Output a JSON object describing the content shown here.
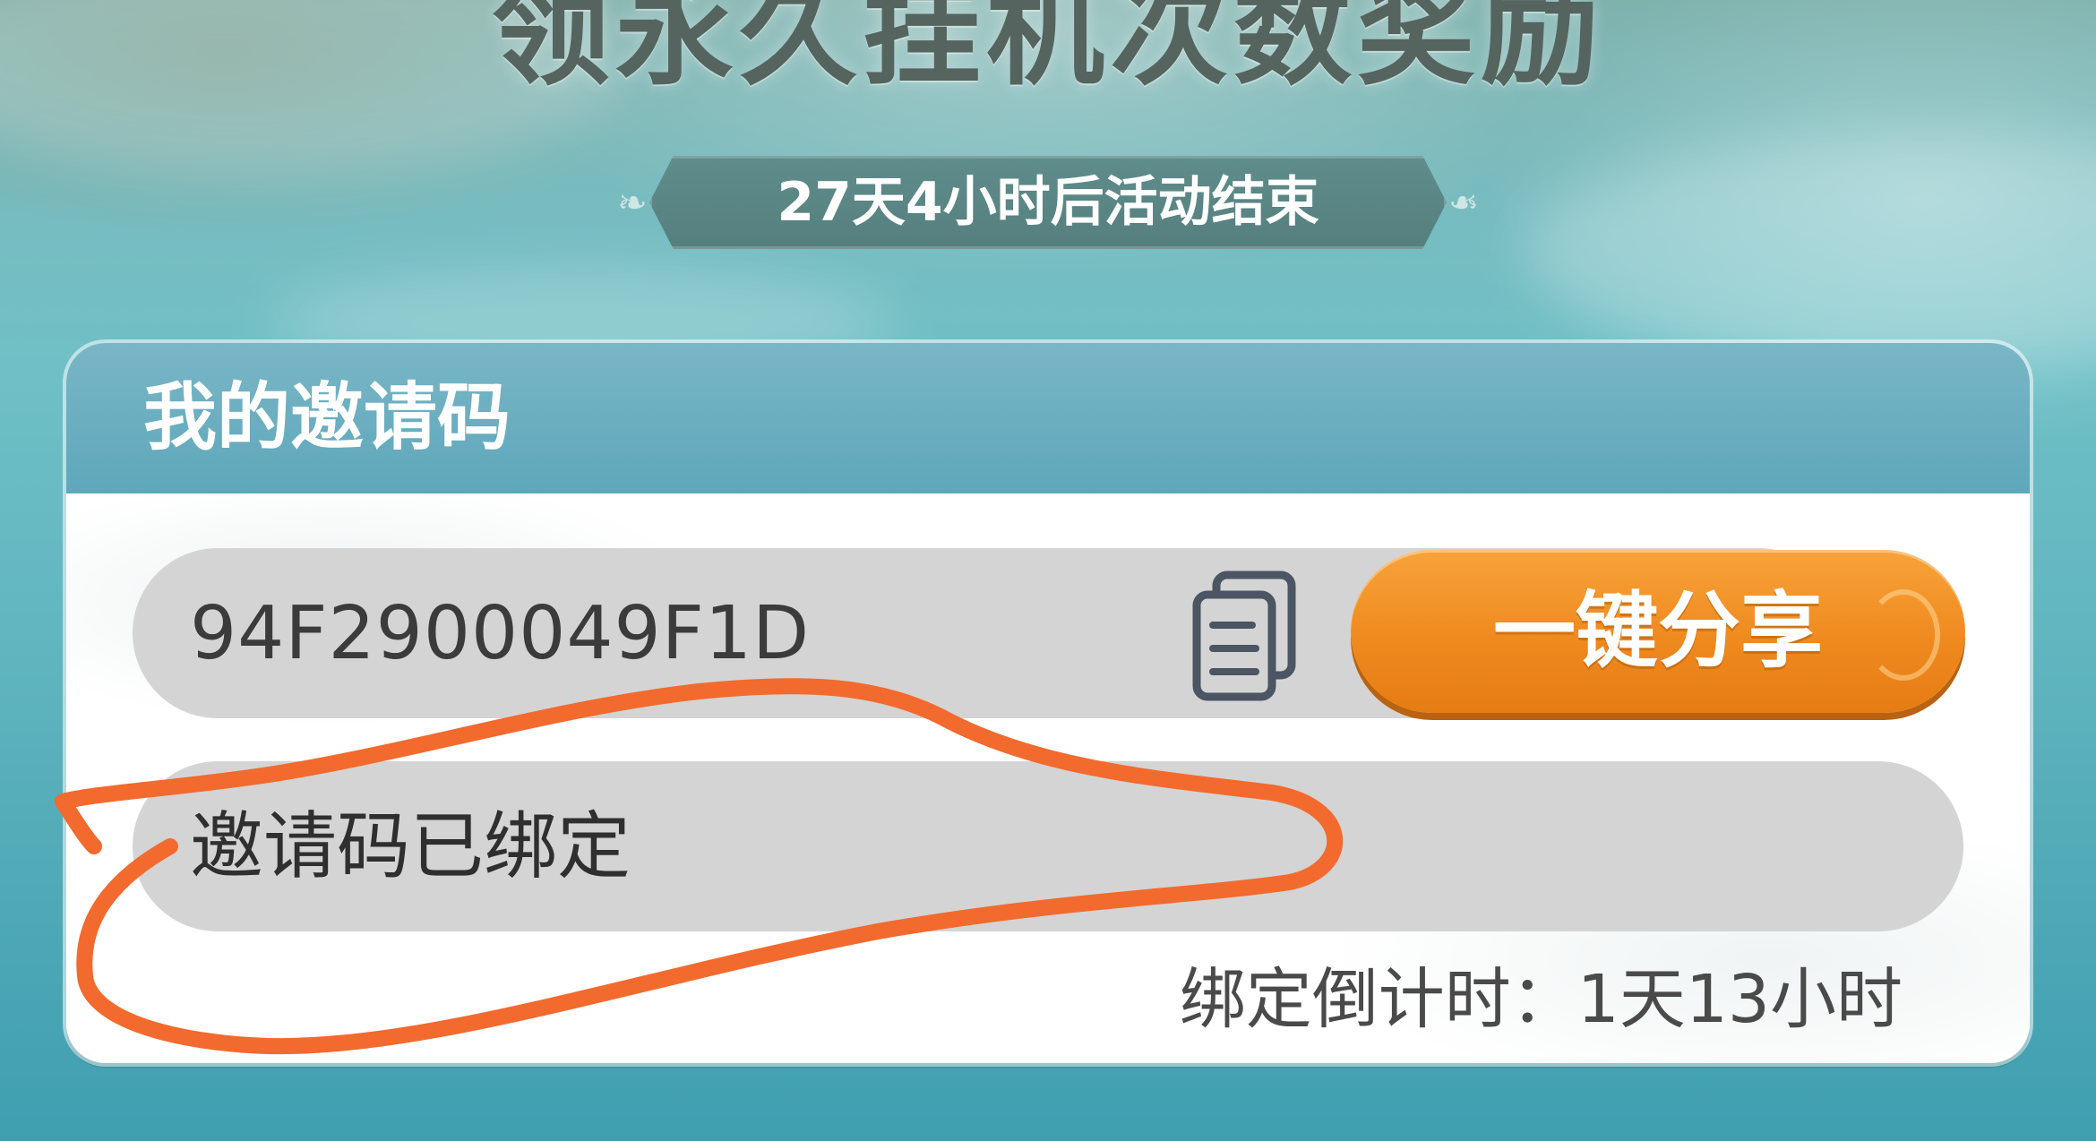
{
  "banner": {
    "title": "领永久挂机次数奖励",
    "timer": "27天4小时后活动结束"
  },
  "invite_panel": {
    "header": "我的邀请码",
    "code": "94F2900049F1D",
    "copy_icon": "copy-icon",
    "share_button": "一键分享",
    "bind_status": "邀请码已绑定",
    "bind_countdown": "绑定倒计时：1天13小时"
  },
  "colors": {
    "accent_orange": "#ef8a1f",
    "header_teal": "#6aadc0",
    "annotation": "#f26a2e"
  }
}
